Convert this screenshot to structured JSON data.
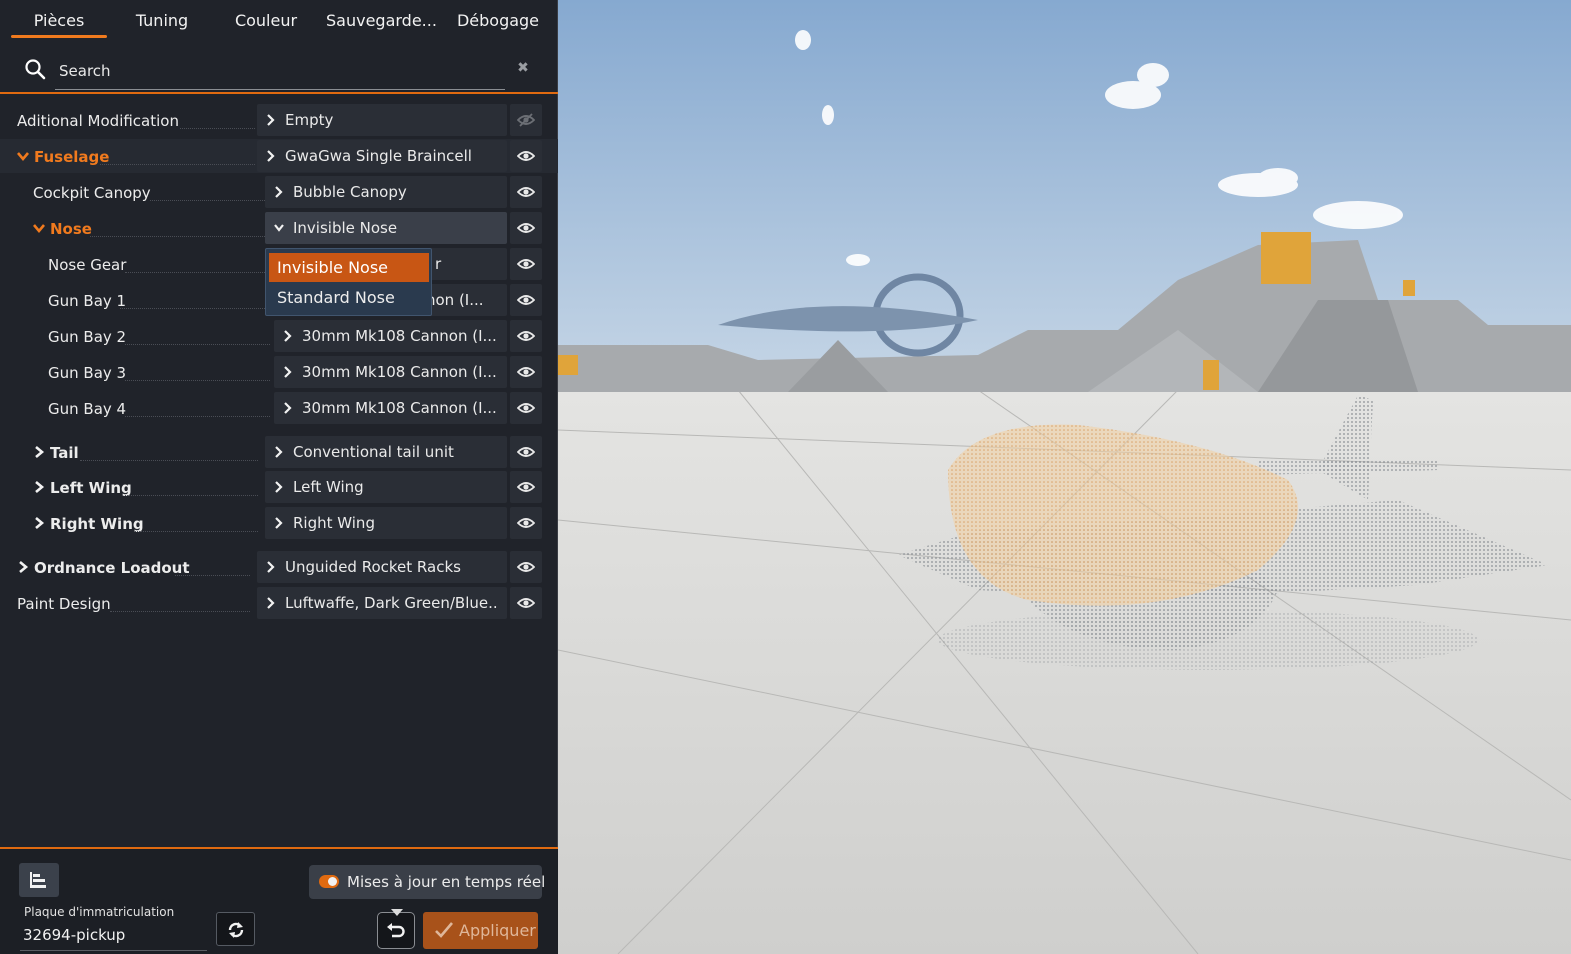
{
  "tabs": [
    {
      "label": "Pièces",
      "active": true
    },
    {
      "label": "Tuning",
      "active": false
    },
    {
      "label": "Couleur",
      "active": false
    },
    {
      "label": "Sauvegarde...",
      "active": false
    },
    {
      "label": "Débogage",
      "active": false
    }
  ],
  "search": {
    "placeholder": "Search",
    "value": ""
  },
  "parts": [
    {
      "name": "Aditional Modification",
      "value": "Empty",
      "expanded": null,
      "visible": false
    },
    {
      "name": "Fuselage",
      "value": "GwaGwa Single Braincell",
      "expanded": true,
      "visible": true
    },
    {
      "name": "Cockpit Canopy",
      "value": "Bubble Canopy",
      "expanded": null,
      "visible": true
    },
    {
      "name": "Nose",
      "value": "Invisible Nose",
      "expanded": true,
      "visible": true
    },
    {
      "name": "Nose Gear",
      "value": "r",
      "expanded": null,
      "visible": true
    },
    {
      "name": "Gun Bay 1",
      "value": "non (I...",
      "expanded": null,
      "visible": true
    },
    {
      "name": "Gun Bay 2",
      "value": "30mm Mk108 Cannon (I...",
      "expanded": null,
      "visible": true
    },
    {
      "name": "Gun Bay 3",
      "value": "30mm Mk108 Cannon (I...",
      "expanded": null,
      "visible": true
    },
    {
      "name": "Gun Bay 4",
      "value": "30mm Mk108 Cannon (I...",
      "expanded": null,
      "visible": true
    },
    {
      "name": "Tail",
      "value": "Conventional tail unit",
      "expanded": false,
      "visible": true
    },
    {
      "name": "Left Wing",
      "value": "Left Wing",
      "expanded": false,
      "visible": true
    },
    {
      "name": "Right Wing",
      "value": "Right Wing",
      "expanded": false,
      "visible": true
    },
    {
      "name": "Ordnance Loadout",
      "value": "Unguided Rocket Racks",
      "expanded": false,
      "visible": true
    },
    {
      "name": "Paint Design",
      "value": "Luftwaffe, Dark Green/Blue...",
      "expanded": null,
      "visible": true
    }
  ],
  "nose_dropdown": {
    "options": [
      "Invisible Nose",
      "Standard Nose"
    ],
    "selected": "Invisible Nose"
  },
  "footer": {
    "realtime_label": "Mises à jour en temps réel",
    "realtime_on": true,
    "plate_label": "Plaque d'immatriculation",
    "plate_value": "32694-pickup",
    "apply_label": "Appliquer"
  },
  "colors": {
    "accent": "#f07a1e",
    "panel_bg": "#20232a",
    "dropdown_bg": "#2a3a4e",
    "selected_option": "#c85614",
    "apply_bg": "#a8521a",
    "sky": "#8fb0d4",
    "ground": "#d8d8d6"
  }
}
